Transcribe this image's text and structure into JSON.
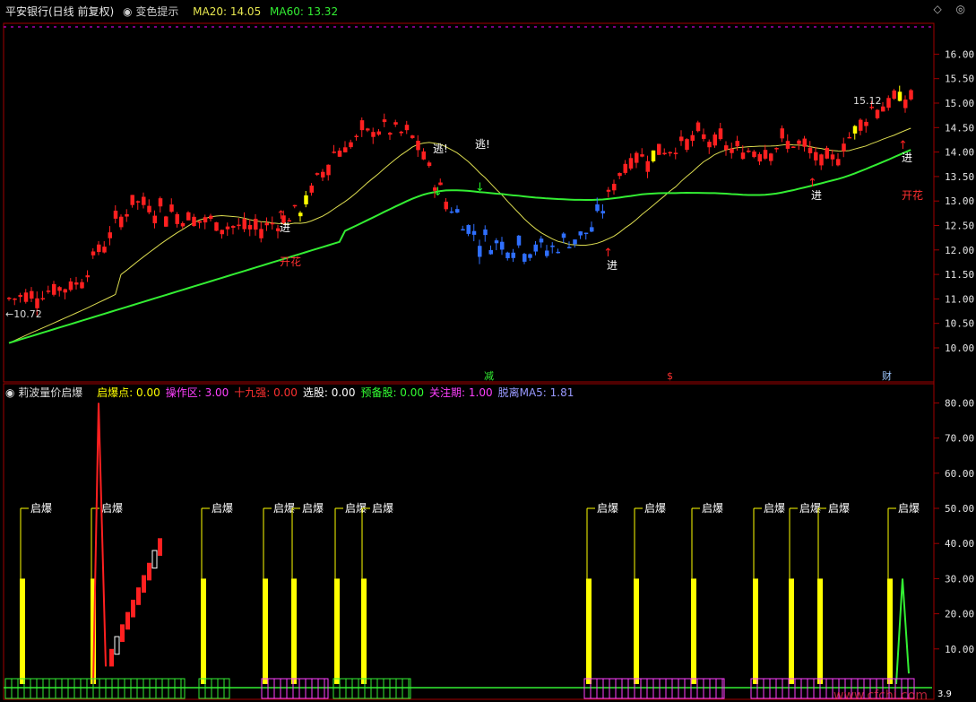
{
  "main_header": {
    "title": "平安银行(日线 前复权)",
    "indicator": "变色提示",
    "ma20_label": "MA20: 14.05",
    "ma60_label": "MA60: 13.32"
  },
  "sub_header": {
    "title": "莉波量价启爆",
    "items": [
      {
        "label": "启爆点: 0.00",
        "color": "#ffff00"
      },
      {
        "label": "操作区: 3.00",
        "color": "#ff40ff"
      },
      {
        "label": "十九强: 0.00",
        "color": "#ff3030"
      },
      {
        "label": "选股: 0.00",
        "color": "#ffffff"
      },
      {
        "label": "预备股: 0.00",
        "color": "#33ff33"
      },
      {
        "label": "关注期: 1.00",
        "color": "#ff40ff"
      },
      {
        "label": "脱离MA5: 1.81",
        "color": "#9999ff"
      }
    ]
  },
  "window_icons": "◇ ◎",
  "main_axis": [
    "16.00",
    "15.50",
    "15.00",
    "14.50",
    "14.00",
    "13.50",
    "13.00",
    "12.50",
    "12.00",
    "11.50",
    "11.00",
    "10.50",
    "10.00"
  ],
  "sub_axis": [
    "80.00",
    "70.00",
    "60.00",
    "50.00",
    "40.00",
    "30.00",
    "20.00",
    "10.00"
  ],
  "annotations": {
    "low_price": "10.72",
    "high_price": "15.12",
    "escape": "逃!",
    "enter": "进",
    "bloom": "开花",
    "burst": "启爆",
    "event_reduce": "减",
    "event_dollar": "$",
    "event_finance": "财",
    "watermark": "www.cfchi.com",
    "corner_value": "3.9"
  },
  "colors": {
    "up": "#ff2020",
    "down": "#2f6fff",
    "highlight": "#ffff00",
    "ma_short": "#dcdc50",
    "ma_long": "#33ee33",
    "frame": "#b00000"
  }
}
